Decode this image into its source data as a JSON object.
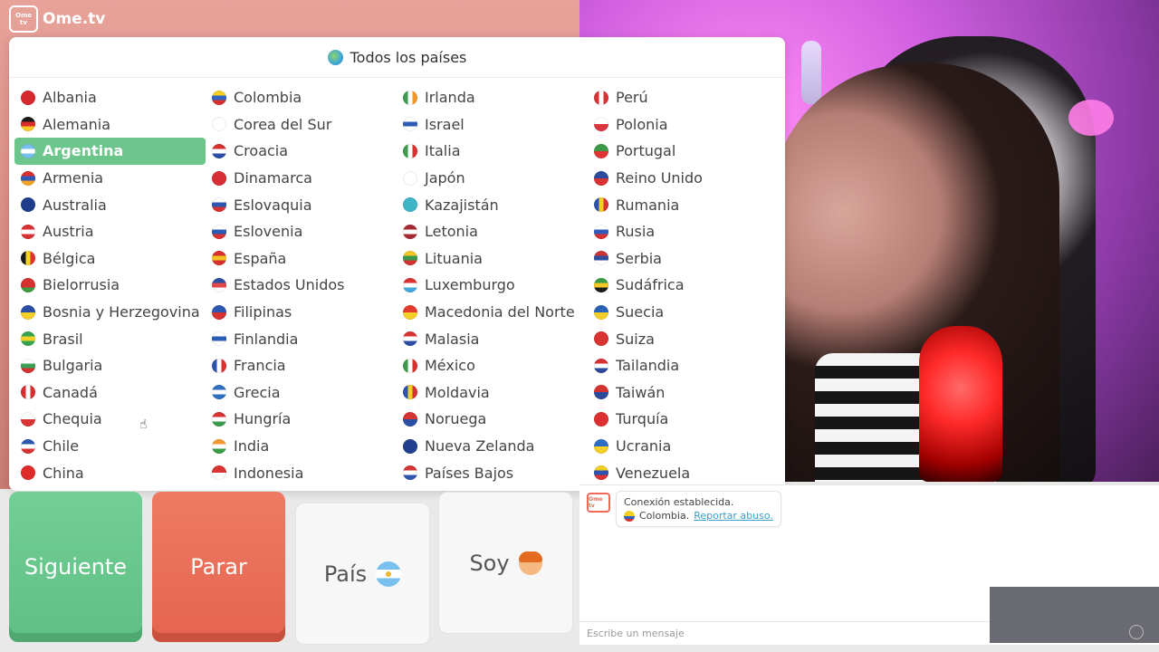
{
  "app": {
    "logo_box": "Ome tv",
    "logo_text": "Ome.tv"
  },
  "country_panel": {
    "title": "Todos los países",
    "countries": [
      {
        "name": "Albania",
        "flag": [
          "#d6292d",
          "#d6292d"
        ]
      },
      {
        "name": "Alemania",
        "flag": [
          "#1b1b1b",
          "#dd2a2a",
          "#f6c727"
        ]
      },
      {
        "name": "Argentina",
        "flag": [
          "#7ac0ef",
          "#ffffff",
          "#7ac0ef"
        ],
        "selected": true
      },
      {
        "name": "Armenia",
        "flag": [
          "#d63030",
          "#2f58b5",
          "#f2a525"
        ]
      },
      {
        "name": "Australia",
        "flag": [
          "#203d8c",
          "#203d8c"
        ]
      },
      {
        "name": "Austria",
        "flag": [
          "#d63233",
          "#ffffff",
          "#d63233"
        ]
      },
      {
        "name": "Bélgica",
        "flag": [
          "#1b1b1b",
          "#f6d427",
          "#e03131"
        ],
        "vertical": true
      },
      {
        "name": "Bielorrusia",
        "flag": [
          "#d63131",
          "#d63131",
          "#3f9a43"
        ]
      },
      {
        "name": "Bosnia y Herzegovina",
        "flag": [
          "#2a4ea4",
          "#f6cf2a"
        ]
      },
      {
        "name": "Brasil",
        "flag": [
          "#36a350",
          "#f3d22a",
          "#36a350"
        ]
      },
      {
        "name": "Bulgaria",
        "flag": [
          "#ffffff",
          "#3aa055",
          "#d53131"
        ]
      },
      {
        "name": "Canadá",
        "flag": [
          "#d52f2f",
          "#ffffff",
          "#d52f2f"
        ],
        "vertical": true
      },
      {
        "name": "Chequia",
        "flag": [
          "#ffffff",
          "#d93434"
        ]
      },
      {
        "name": "Chile",
        "flag": [
          "#2c55b0",
          "#ffffff",
          "#d63232"
        ]
      },
      {
        "name": "China",
        "flag": [
          "#de2c2c",
          "#de2c2c"
        ]
      },
      {
        "name": "Colombia",
        "flag": [
          "#f5d020",
          "#2f66c4",
          "#d8312f"
        ]
      },
      {
        "name": "Corea del Sur",
        "flag": [
          "#ffffff",
          "#ffffff"
        ]
      },
      {
        "name": "Croacia",
        "flag": [
          "#d63131",
          "#ffffff",
          "#2a4fa6"
        ]
      },
      {
        "name": "Dinamarca",
        "flag": [
          "#d72f35",
          "#d72f35"
        ]
      },
      {
        "name": "Eslovaquia",
        "flag": [
          "#ffffff",
          "#2b57b0",
          "#d63232"
        ]
      },
      {
        "name": "Eslovenia",
        "flag": [
          "#ffffff",
          "#2a5bb5",
          "#d73131"
        ]
      },
      {
        "name": "España",
        "flag": [
          "#d8302c",
          "#f4c426",
          "#d8302c"
        ]
      },
      {
        "name": "Estados Unidos",
        "flag": [
          "#2c4f9e",
          "#e34848",
          "#ffffff"
        ]
      },
      {
        "name": "Filipinas",
        "flag": [
          "#2c56b0",
          "#d63232"
        ]
      },
      {
        "name": "Finlandia",
        "flag": [
          "#ffffff",
          "#2c5db5",
          "#ffffff"
        ]
      },
      {
        "name": "Francia",
        "flag": [
          "#2c52b0",
          "#ffffff",
          "#dd3030"
        ],
        "vertical": true
      },
      {
        "name": "Grecia",
        "flag": [
          "#2f6fc2",
          "#ffffff",
          "#2f6fc2"
        ]
      },
      {
        "name": "Hungría",
        "flag": [
          "#d63232",
          "#ffffff",
          "#3b9b4d"
        ]
      },
      {
        "name": "India",
        "flag": [
          "#f2982d",
          "#ffffff",
          "#3a9b45"
        ]
      },
      {
        "name": "Indonesia",
        "flag": [
          "#d93333",
          "#ffffff"
        ]
      },
      {
        "name": "Irlanda",
        "flag": [
          "#3b9e4e",
          "#ffffff",
          "#f2982d"
        ],
        "vertical": true
      },
      {
        "name": "Israel",
        "flag": [
          "#ffffff",
          "#2c5cb6",
          "#ffffff"
        ]
      },
      {
        "name": "Italia",
        "flag": [
          "#3b9d4d",
          "#ffffff",
          "#d83232"
        ],
        "vertical": true
      },
      {
        "name": "Japón",
        "flag": [
          "#ffffff",
          "#ffffff"
        ]
      },
      {
        "name": "Kazajistán",
        "flag": [
          "#3eb6c8",
          "#3eb6c8"
        ]
      },
      {
        "name": "Letonia",
        "flag": [
          "#a52a34",
          "#ffffff",
          "#a52a34"
        ]
      },
      {
        "name": "Lituania",
        "flag": [
          "#f3c726",
          "#3a9a4b",
          "#d23131"
        ]
      },
      {
        "name": "Luxemburgo",
        "flag": [
          "#d83333",
          "#ffffff",
          "#43a7dc"
        ]
      },
      {
        "name": "Macedonia del Norte",
        "flag": [
          "#e33b2b",
          "#f5cf26"
        ]
      },
      {
        "name": "Malasia",
        "flag": [
          "#d83232",
          "#ffffff",
          "#2d4ea2"
        ]
      },
      {
        "name": "México",
        "flag": [
          "#3b9b4c",
          "#ffffff",
          "#d63232"
        ],
        "vertical": true
      },
      {
        "name": "Moldavia",
        "flag": [
          "#2c53b0",
          "#f5cf28",
          "#d63232"
        ],
        "vertical": true
      },
      {
        "name": "Noruega",
        "flag": [
          "#d63333",
          "#2c4fa6"
        ]
      },
      {
        "name": "Nueva Zelanda",
        "flag": [
          "#233f8f",
          "#233f8f"
        ]
      },
      {
        "name": "Países Bajos",
        "flag": [
          "#d23636",
          "#ffffff",
          "#2f56ad"
        ]
      },
      {
        "name": "Perú",
        "flag": [
          "#d83232",
          "#ffffff",
          "#d83232"
        ],
        "vertical": true
      },
      {
        "name": "Polonia",
        "flag": [
          "#ffffff",
          "#dd3640"
        ]
      },
      {
        "name": "Portugal",
        "flag": [
          "#3a9a46",
          "#e33232"
        ]
      },
      {
        "name": "Reino Unido",
        "flag": [
          "#2b4a9c",
          "#d83232"
        ]
      },
      {
        "name": "Rumania",
        "flag": [
          "#2b52b0",
          "#f6d02a",
          "#d83232"
        ],
        "vertical": true
      },
      {
        "name": "Rusia",
        "flag": [
          "#ffffff",
          "#2f5bbf",
          "#d93232"
        ]
      },
      {
        "name": "Serbia",
        "flag": [
          "#c93437",
          "#2e4d9e",
          "#ffffff"
        ]
      },
      {
        "name": "Sudáfrica",
        "flag": [
          "#3a9d46",
          "#f3c726",
          "#1b1b1b"
        ]
      },
      {
        "name": "Suecia",
        "flag": [
          "#2a62b5",
          "#f6d02a"
        ]
      },
      {
        "name": "Suiza",
        "flag": [
          "#d83232",
          "#d83232"
        ]
      },
      {
        "name": "Tailandia",
        "flag": [
          "#d63232",
          "#ffffff",
          "#2b4a9c"
        ]
      },
      {
        "name": "Taiwán",
        "flag": [
          "#d63232",
          "#2b4a9c"
        ]
      },
      {
        "name": "Turquía",
        "flag": [
          "#dd3030",
          "#dd3030"
        ]
      },
      {
        "name": "Ucrania",
        "flag": [
          "#2f6ec5",
          "#f6d02a"
        ]
      },
      {
        "name": "Venezuela",
        "flag": [
          "#f5cf26",
          "#2c53b0",
          "#d83232"
        ]
      }
    ]
  },
  "controls": {
    "next": "Siguiente",
    "stop": "Parar",
    "country": "País",
    "gender": "Soy"
  },
  "chat": {
    "logo": "Ome tv",
    "connected": "Conexión establecida.",
    "country": "Colombia.",
    "report": "Reportar abuso.",
    "placeholder": "Escribe un mensaje"
  }
}
